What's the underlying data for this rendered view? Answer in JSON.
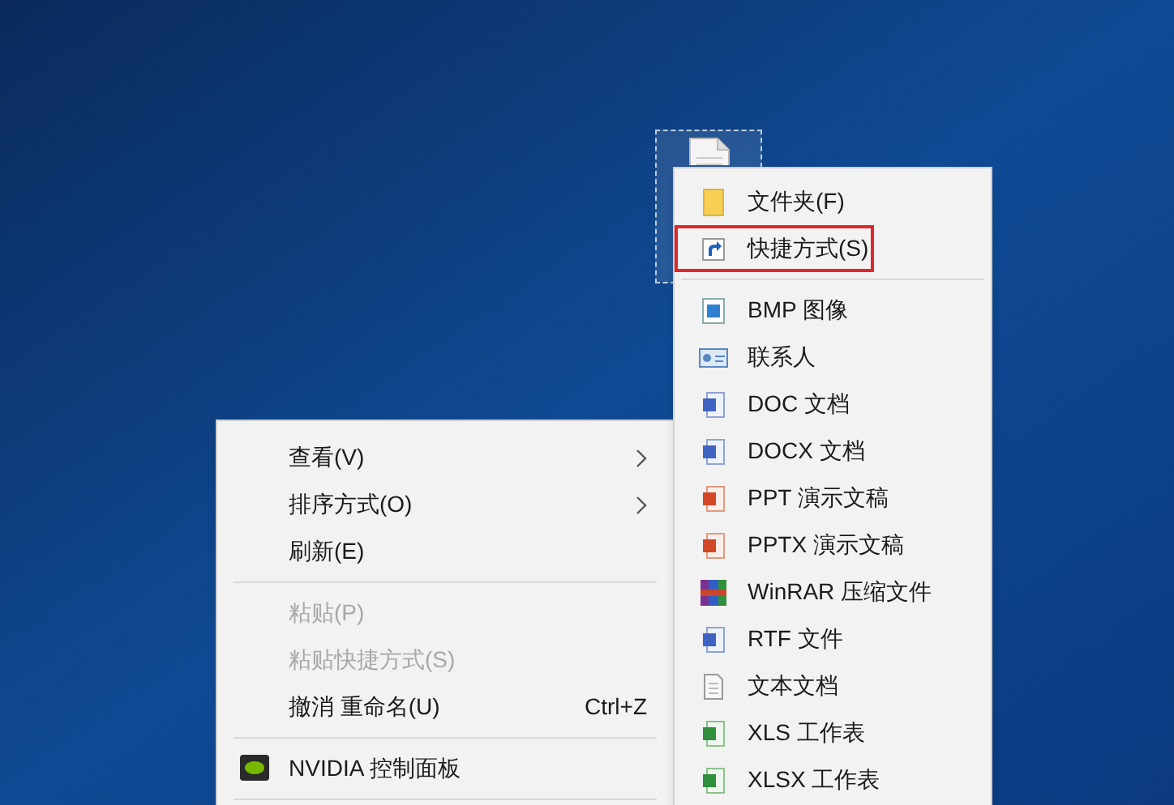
{
  "desktop_menu": [
    {
      "kind": "item",
      "label": "查看(V)",
      "submenu": true,
      "disabled": false
    },
    {
      "kind": "item",
      "label": "排序方式(O)",
      "submenu": true,
      "disabled": false
    },
    {
      "kind": "item",
      "label": "刷新(E)",
      "submenu": false,
      "disabled": false
    },
    {
      "kind": "separator"
    },
    {
      "kind": "item",
      "label": "粘贴(P)",
      "submenu": false,
      "disabled": true
    },
    {
      "kind": "item",
      "label": "粘贴快捷方式(S)",
      "submenu": false,
      "disabled": true
    },
    {
      "kind": "item",
      "label": "撤消 重命名(U)",
      "shortcut": "Ctrl+Z",
      "submenu": false,
      "disabled": false
    },
    {
      "kind": "separator"
    },
    {
      "kind": "app",
      "label": "NVIDIA 控制面板",
      "submenu": false,
      "disabled": false
    },
    {
      "kind": "separator"
    }
  ],
  "new_submenu": [
    {
      "kind": "folder",
      "label": "文件夹(F)",
      "highlighted": false
    },
    {
      "kind": "shortcut",
      "label": "快捷方式(S)",
      "highlighted": true
    },
    {
      "kind": "separator"
    },
    {
      "kind": "image",
      "label": "BMP 图像",
      "highlighted": false
    },
    {
      "kind": "contact",
      "label": "联系人",
      "highlighted": false
    },
    {
      "kind": "word",
      "label": "DOC 文档",
      "highlighted": false
    },
    {
      "kind": "word",
      "label": "DOCX 文档",
      "highlighted": false
    },
    {
      "kind": "ppt",
      "label": "PPT 演示文稿",
      "highlighted": false
    },
    {
      "kind": "ppt",
      "label": "PPTX 演示文稿",
      "highlighted": false
    },
    {
      "kind": "rar",
      "label": "WinRAR 压缩文件",
      "highlighted": false
    },
    {
      "kind": "word",
      "label": "RTF 文件",
      "highlighted": false
    },
    {
      "kind": "text",
      "label": "文本文档",
      "highlighted": false
    },
    {
      "kind": "excel",
      "label": "XLS 工作表",
      "highlighted": false
    },
    {
      "kind": "excel",
      "label": "XLSX 工作表",
      "highlighted": false
    }
  ]
}
